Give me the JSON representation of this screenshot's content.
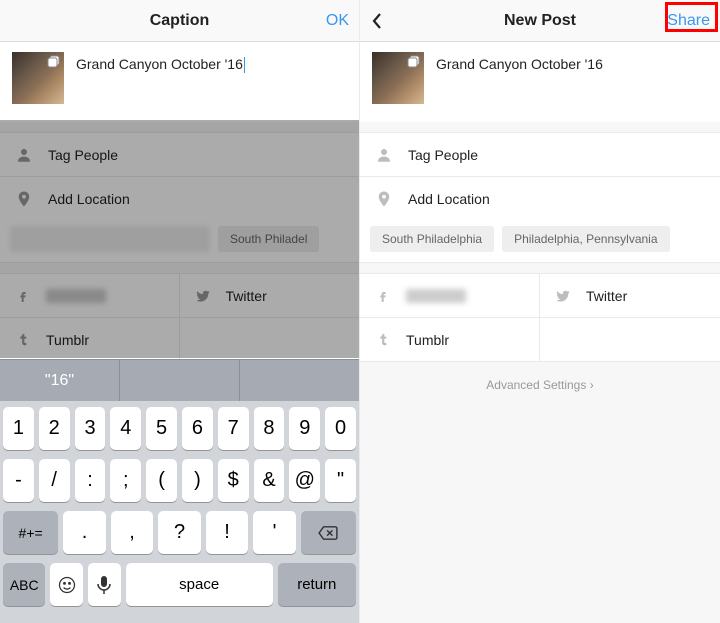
{
  "left": {
    "header": {
      "title": "Caption",
      "ok": "OK"
    },
    "caption": "Grand Canyon October '16",
    "rows": {
      "tag_people": "Tag People",
      "add_location": "Add Location"
    },
    "location_chips": [
      "South Philadel"
    ],
    "share": {
      "twitter": "Twitter",
      "tumblr": "Tumblr"
    },
    "keyboard": {
      "suggestion": "\"16\"",
      "row1": [
        "1",
        "2",
        "3",
        "4",
        "5",
        "6",
        "7",
        "8",
        "9",
        "0"
      ],
      "row2": [
        "-",
        "/",
        ":",
        ";",
        "(",
        ")",
        "$",
        "&",
        "@",
        "\""
      ],
      "row3_switch": "#+=",
      "row3": [
        ".",
        ",",
        "?",
        "!",
        "'"
      ],
      "row4": {
        "abc": "ABC",
        "space": "space",
        "return": "return"
      }
    }
  },
  "right": {
    "header": {
      "title": "New Post",
      "share": "Share"
    },
    "caption": "Grand Canyon October '16",
    "rows": {
      "tag_people": "Tag People",
      "add_location": "Add Location"
    },
    "location_chips": [
      "South Philadelphia",
      "Philadelphia, Pennsylvania"
    ],
    "share": {
      "twitter": "Twitter",
      "tumblr": "Tumblr"
    },
    "advanced": "Advanced Settings"
  }
}
